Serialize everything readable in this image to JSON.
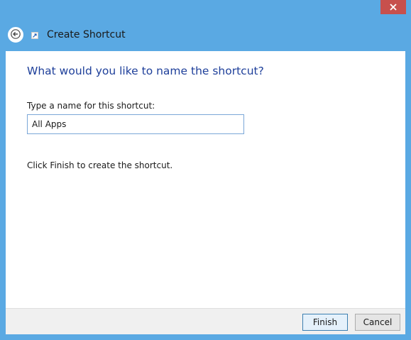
{
  "window": {
    "title": "Create Shortcut",
    "frame_color": "#5aa9e3",
    "close_color": "#c7504d"
  },
  "icons": {
    "close": "close-icon",
    "back": "back-arrow-icon",
    "shortcut": "shortcut-icon"
  },
  "main": {
    "heading": "What would you like to name the shortcut?",
    "field_label": "Type a name for this shortcut:",
    "name_value": "All Apps",
    "instruction": "Click Finish to create the shortcut."
  },
  "footer": {
    "finish_label": "Finish",
    "cancel_label": "Cancel"
  }
}
